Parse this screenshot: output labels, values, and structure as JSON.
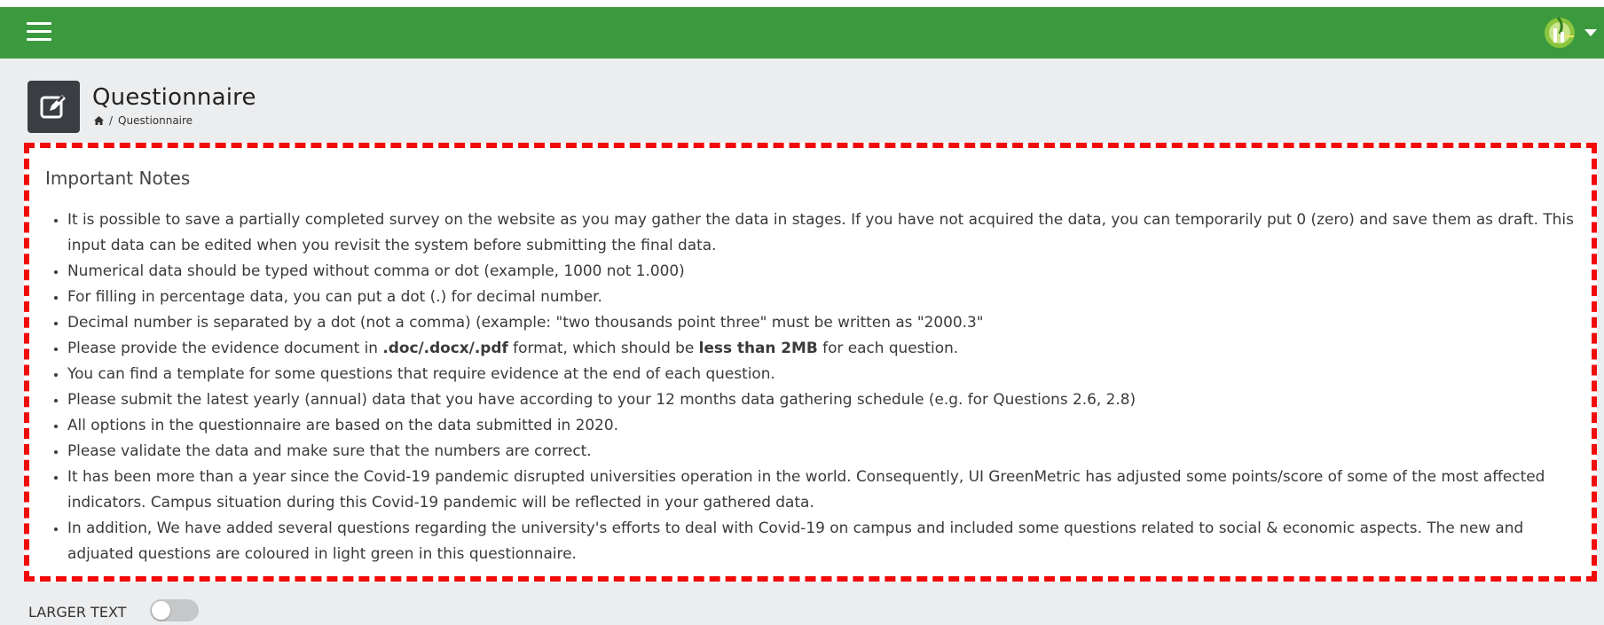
{
  "colors": {
    "topbar": "#3c9a3e",
    "page_icon_bg": "#3a3d42",
    "notes_border": "#f20b0b",
    "background": "#ecedef",
    "toggle_off": "#c6c7c9"
  },
  "topbar": {
    "menu_icon": "hamburger-icon",
    "user_menu_icon": "university-logo-icon"
  },
  "header": {
    "title": "Questionnaire",
    "icon": "edit-icon",
    "breadcrumb": {
      "home_icon": "home-icon",
      "separator": "/",
      "current": "Questionnaire"
    }
  },
  "notes": {
    "title": "Important Notes",
    "items": [
      {
        "parts": [
          {
            "text": "It is possible to save a partially completed survey on the website as you may gather the data in stages. If you have not acquired the data, you can temporarily put 0 (zero) and save them as draft. This input data can be edited when you revisit the system before submitting the final data."
          }
        ]
      },
      {
        "parts": [
          {
            "text": "Numerical data should be typed without comma or dot (example, 1000 not 1.000)"
          }
        ]
      },
      {
        "parts": [
          {
            "text": "For filling in percentage data, you can put a dot (.) for decimal number."
          }
        ]
      },
      {
        "parts": [
          {
            "text": "Decimal number is separated by a dot (not a comma) (example: \"two thousands point three\" must be written as \"2000.3\""
          }
        ]
      },
      {
        "parts": [
          {
            "text": "Please provide the evidence document in "
          },
          {
            "text": ".doc/.docx/.pdf",
            "bold": true
          },
          {
            "text": " format, which should be "
          },
          {
            "text": "less than 2MB",
            "bold": true
          },
          {
            "text": " for each question."
          }
        ]
      },
      {
        "parts": [
          {
            "text": "You can find a template for some questions that require evidence at the end of each question."
          }
        ]
      },
      {
        "parts": [
          {
            "text": "Please submit the latest yearly (annual) data that you have according to your 12 months data gathering schedule (e.g. for Questions 2.6, 2.8)"
          }
        ]
      },
      {
        "parts": [
          {
            "text": "All options in the questionnaire are based on the data submitted in 2020."
          }
        ]
      },
      {
        "parts": [
          {
            "text": "Please validate the data and make sure that the numbers are correct."
          }
        ]
      },
      {
        "parts": [
          {
            "text": "It has been more than a year since the Covid-19 pandemic disrupted universities operation in the world. Consequently, UI GreenMetric has adjusted some points/score of some of the most affected indicators. Campus situation during this Covid-19 pandemic will be reflected in your gathered data."
          }
        ]
      },
      {
        "parts": [
          {
            "text": "In addition, We have added several questions regarding the university's efforts to deal with Covid-19 on campus and included some questions related to social & economic aspects. The new and adjuated questions are coloured in light green in this questionnaire."
          }
        ]
      }
    ]
  },
  "larger_text": {
    "label": "LARGER TEXT",
    "enabled": false
  }
}
